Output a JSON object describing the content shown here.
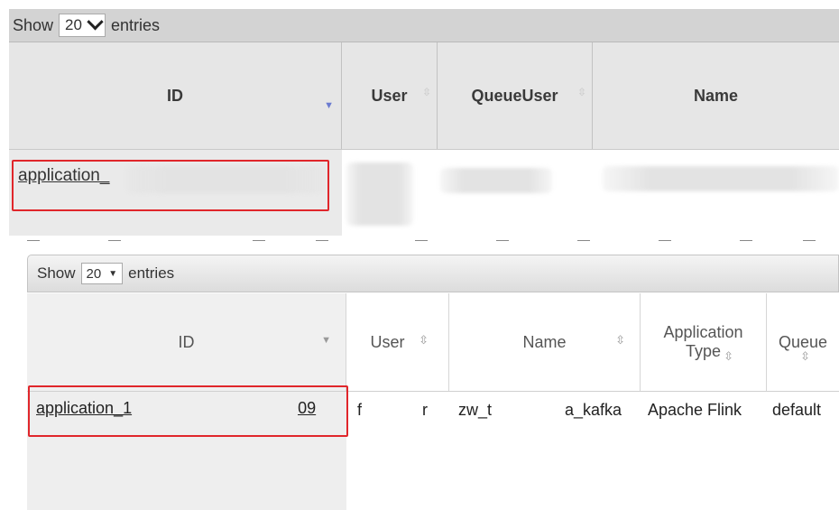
{
  "top_table": {
    "show_label": "Show",
    "entries_value": "20",
    "entries_label": "entries",
    "columns": [
      "ID",
      "User",
      "QueueUser",
      "Name"
    ],
    "row": {
      "id_link": "application_"
    }
  },
  "bottom_table": {
    "show_label": "Show",
    "entries_value": "20",
    "entries_label": "entries",
    "columns": [
      "ID",
      "User",
      "Name",
      "Application Type",
      "Queue"
    ],
    "row": {
      "id_prefix": "application_1",
      "id_suffix": "l_0009",
      "user_start": "f",
      "user_end": "r",
      "name_start": "zw_t",
      "name_end": "a_kafka",
      "app_type": "Apache Flink",
      "queue": "default"
    }
  },
  "colors": {
    "highlight": "#e0262b",
    "sort_active": "#6b7bd0"
  }
}
